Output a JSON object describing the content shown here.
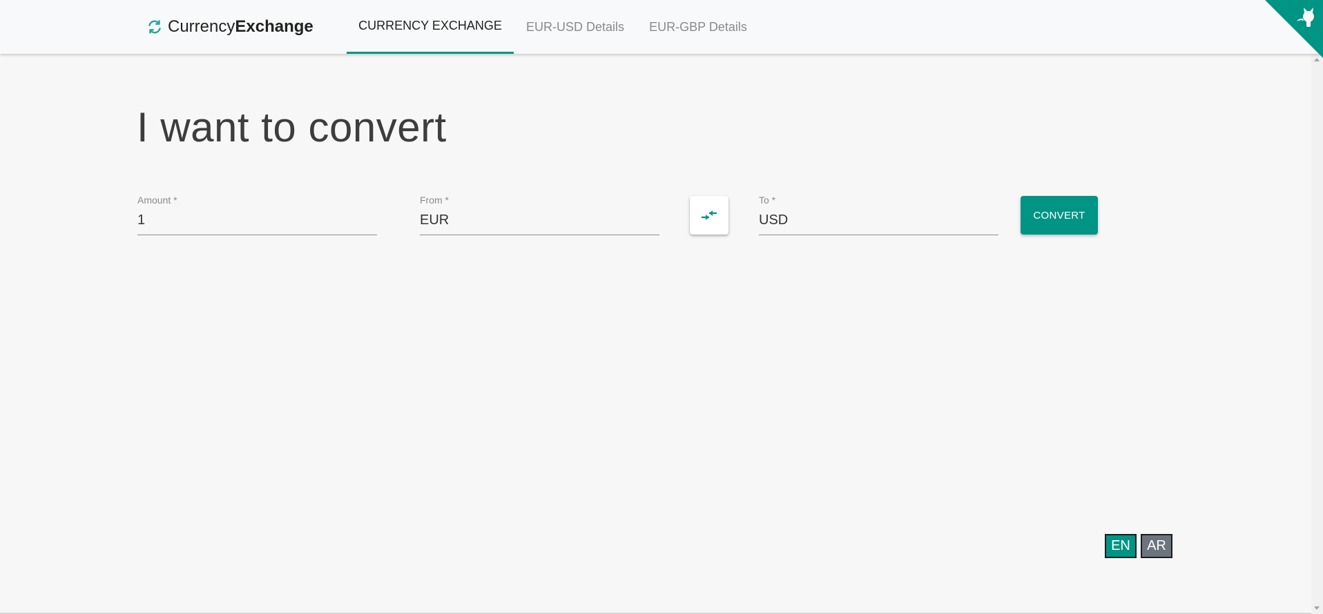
{
  "brand": {
    "name_regular": "Currency",
    "name_bold": "Exchange",
    "icon": "refresh-icon"
  },
  "nav": {
    "tabs": [
      {
        "label": "CURRENCY EXCHANGE",
        "active": true
      },
      {
        "label": "EUR-USD Details",
        "active": false
      },
      {
        "label": "EUR-GBP Details",
        "active": false
      }
    ]
  },
  "main": {
    "heading": "I want to convert",
    "amount": {
      "label": "Amount *",
      "value": "1"
    },
    "from": {
      "label": "From *",
      "value": "EUR"
    },
    "to": {
      "label": "To *",
      "value": "USD"
    },
    "swap_icon": "swap-arrows-icon",
    "convert_label": "CONVERT"
  },
  "language": {
    "options": [
      "EN",
      "AR"
    ],
    "selected": "EN"
  },
  "github_corner": {
    "icon": "github-octocat-icon"
  },
  "colors": {
    "accent": "#009485",
    "secondary": "#6c757d",
    "background": "#f7f7f7",
    "header": "#f8f9fa"
  }
}
